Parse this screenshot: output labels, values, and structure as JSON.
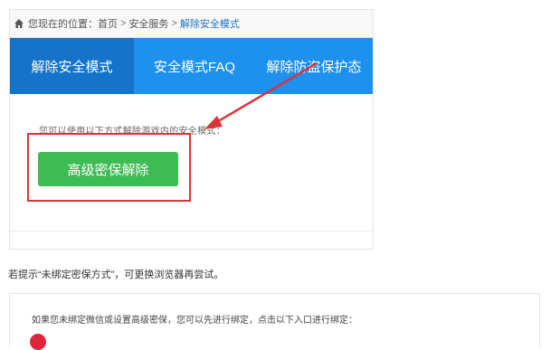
{
  "breadcrumb": {
    "prefix": "您现在的位置：",
    "items": [
      "首页",
      "安全服务"
    ],
    "separator": ">",
    "current": "解除安全模式"
  },
  "tabs": [
    {
      "label": "解除安全模式",
      "active": true
    },
    {
      "label": "安全模式FAQ",
      "active": false
    },
    {
      "label": "解除防盗保护态",
      "active": false
    }
  ],
  "content": {
    "hint": "您可以使用以下方式解除游戏内的安全模式：",
    "unlock_button": "高级密保解除"
  },
  "tip": "若提示“未绑定密保方式”，可更换浏览器再尝试。",
  "panel2": {
    "text": "如果您未绑定微信或设置高级密保，您可以先进行绑定，点击以下入口进行绑定："
  },
  "colors": {
    "tab_bar": "#1e90ee",
    "tab_active": "#1573c9",
    "button": "#3dbc53",
    "annotation_red": "#d9363a"
  }
}
